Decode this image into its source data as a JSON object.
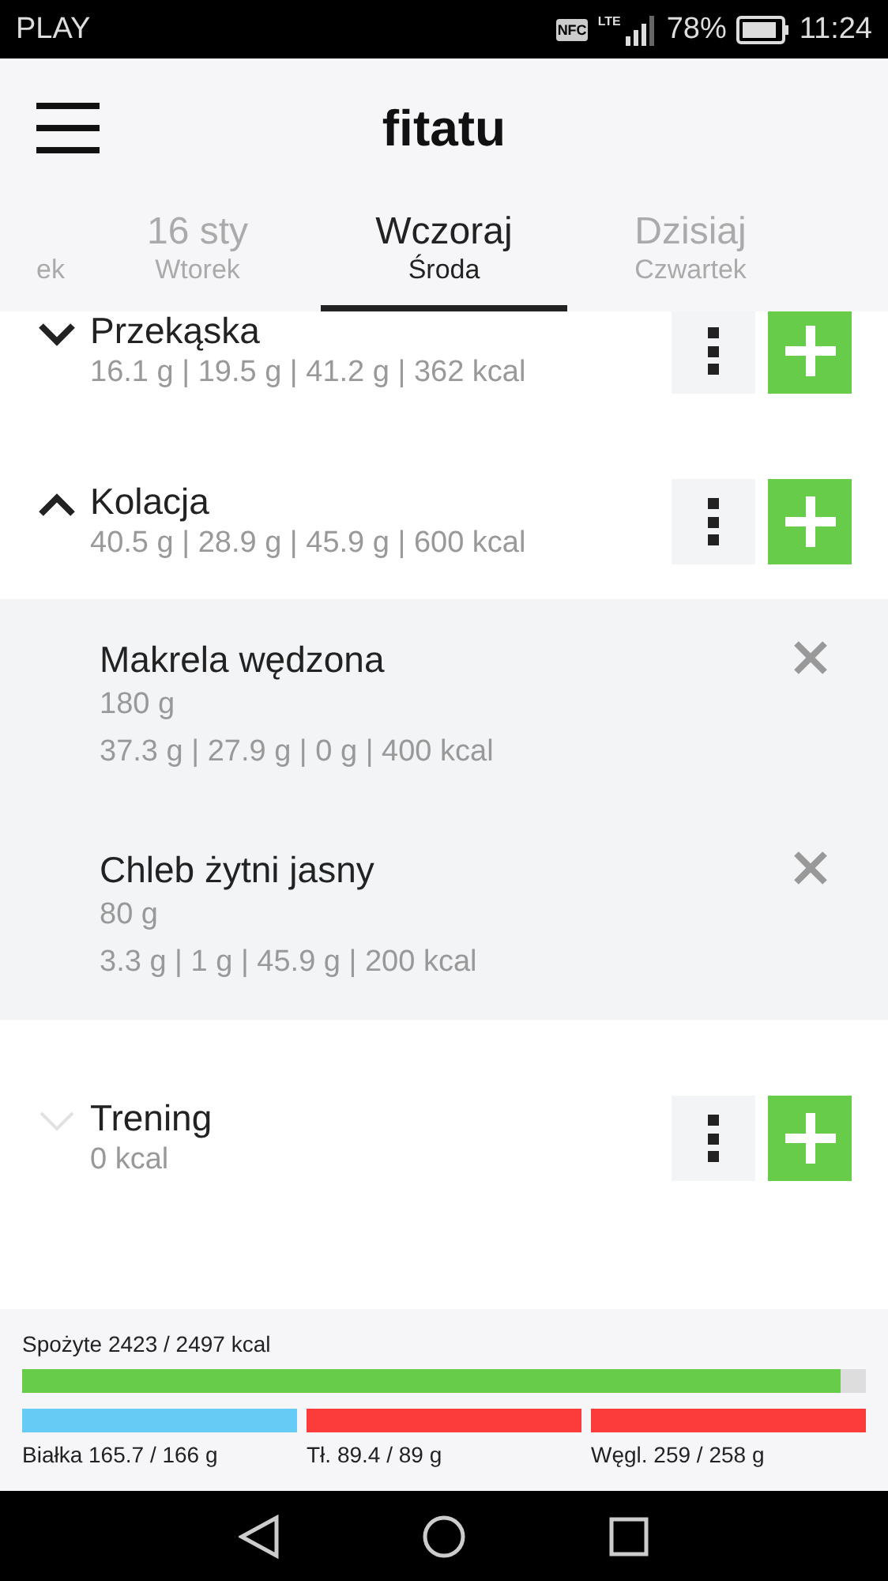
{
  "status_bar": {
    "carrier": "PLAY",
    "nfc": "NFC",
    "network": "LTE",
    "battery": "78%",
    "time": "11:24"
  },
  "app_bar": {
    "logo": "fitatu"
  },
  "tabs": [
    {
      "kind": "partial",
      "subtitle": "ek",
      "selected": false
    },
    {
      "kind": "day",
      "title": "16 sty",
      "subtitle": "Wtorek",
      "selected": false
    },
    {
      "kind": "day",
      "title": "Wczoraj",
      "subtitle": "Środa",
      "selected": true
    },
    {
      "kind": "day",
      "title": "Dzisiaj",
      "subtitle": "Czwartek",
      "selected": false
    }
  ],
  "meals": [
    {
      "name": "Przekąska",
      "summary": "16.1 g | 19.5 g | 41.2 g | 362 kcal",
      "expanded": false,
      "disabled": false
    },
    {
      "name": "Kolacja",
      "summary": "40.5 g | 28.9 g | 45.9 g | 600 kcal",
      "expanded": true,
      "disabled": false,
      "items": [
        {
          "name": "Makrela wędzona",
          "amount": "180 g",
          "macros": "37.3 g | 27.9 g | 0 g | 400 kcal"
        },
        {
          "name": "Chleb żytni jasny",
          "amount": "80 g",
          "macros": "3.3 g | 1 g | 45.9 g | 200 kcal"
        }
      ]
    },
    {
      "name": "Trening",
      "summary": "0 kcal",
      "expanded": false,
      "disabled": true
    }
  ],
  "summary": {
    "label": "Spożyte 2423 / 2497 kcal",
    "level": 0.97,
    "macros": [
      {
        "label": "Białka 165.7 / 166 g",
        "level": 1,
        "color": "#66ccf5"
      },
      {
        "label": "Tł. 89.4 / 89 g",
        "level": 1,
        "color": "#fc3b3b"
      },
      {
        "label": "Węgl. 259 / 258 g",
        "level": 1,
        "color": "#fc3b3b"
      }
    ]
  }
}
